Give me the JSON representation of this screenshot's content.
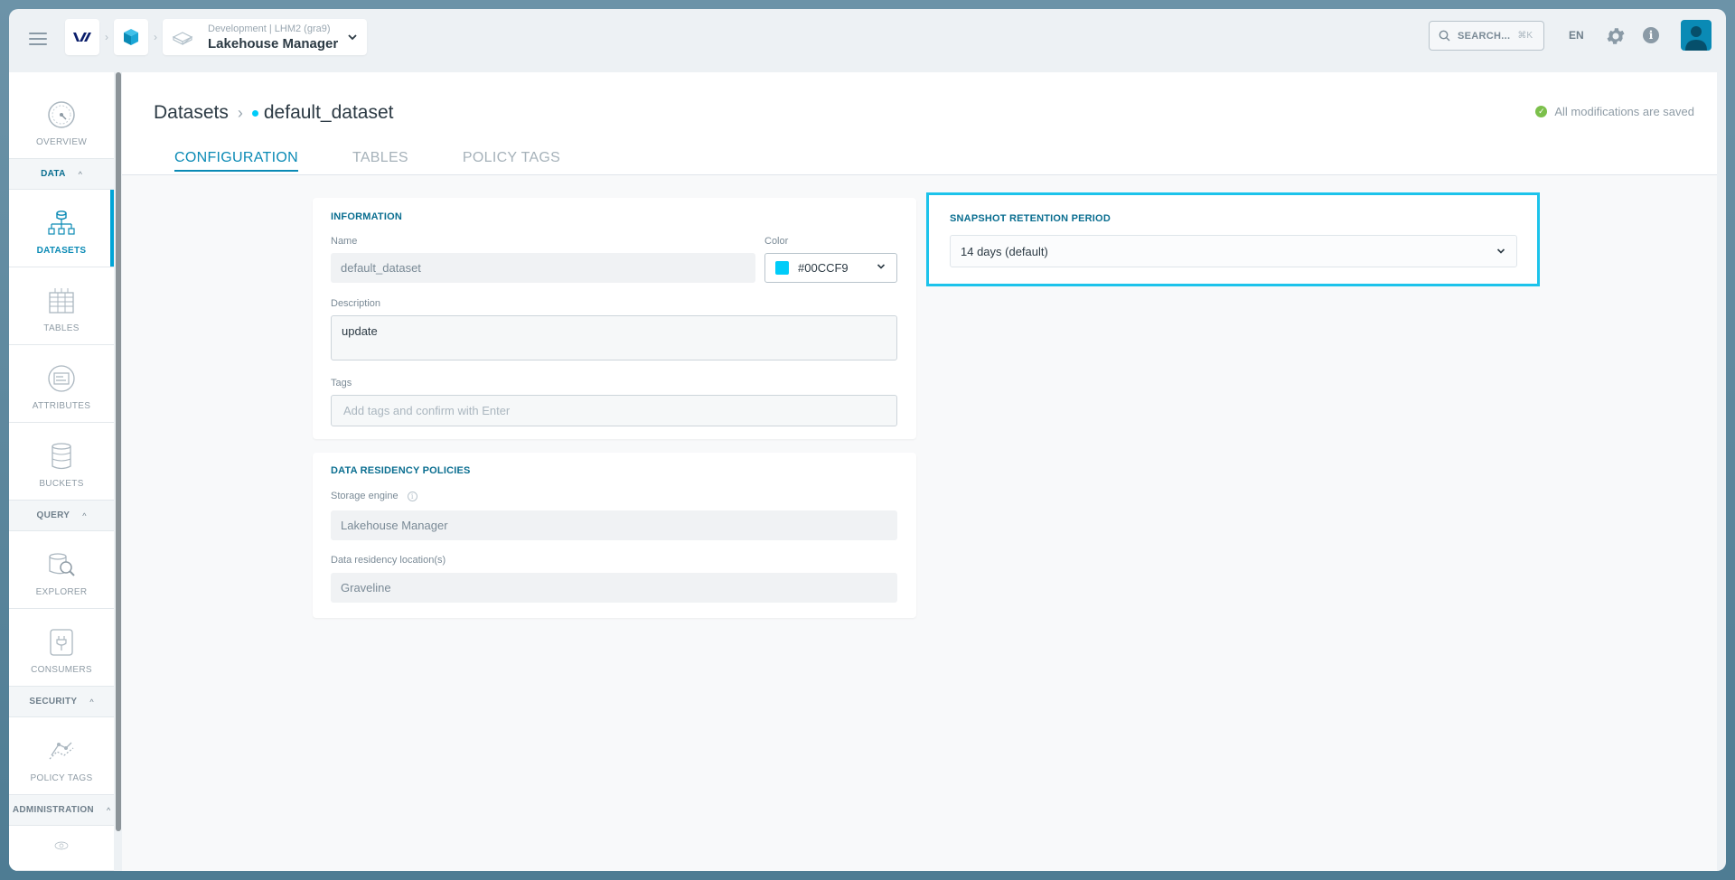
{
  "header": {
    "environment": "Development | LHM2 (gra9)",
    "app_name": "Lakehouse Manager",
    "search_label": "SEARCH...",
    "search_shortcut": "⌘K",
    "language": "EN"
  },
  "sidebar": {
    "overview": "OVERVIEW",
    "sections": {
      "data": "DATA",
      "query": "QUERY",
      "security": "SECURITY",
      "administration": "ADMINISTRATION"
    },
    "items": {
      "datasets": "DATASETS",
      "tables": "TABLES",
      "attributes": "ATTRIBUTES",
      "buckets": "BUCKETS",
      "explorer": "EXPLORER",
      "consumers": "CONSUMERS",
      "policy_tags": "POLICY TAGS"
    }
  },
  "page": {
    "breadcrumb_root": "Datasets",
    "breadcrumb_current": "default_dataset",
    "saved_status": "All modifications are saved",
    "tabs": [
      "CONFIGURATION",
      "TABLES",
      "POLICY TAGS"
    ]
  },
  "information": {
    "title": "INFORMATION",
    "name_label": "Name",
    "name_value": "default_dataset",
    "color_label": "Color",
    "color_value": "#00CCF9",
    "description_label": "Description",
    "description_value": "update",
    "tags_label": "Tags",
    "tags_placeholder": "Add tags and confirm with Enter"
  },
  "residency": {
    "title": "DATA RESIDENCY POLICIES",
    "storage_label": "Storage engine",
    "storage_value": "Lakehouse Manager",
    "location_label": "Data residency location(s)",
    "location_value": "Graveline"
  },
  "snapshot": {
    "title": "SNAPSHOT RETENTION PERIOD",
    "value": "14 days (default)"
  },
  "colors": {
    "accent": "#0a8ab5",
    "dataset_color": "#00ccf9",
    "highlight": "#1cc3eb",
    "success": "#7cc04b"
  }
}
